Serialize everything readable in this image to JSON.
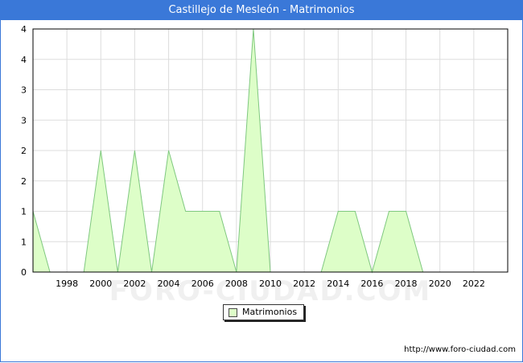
{
  "chart_data": {
    "type": "area",
    "title": "Castillejo de Mesleón - Matrimonios",
    "xlabel": "",
    "ylabel": "",
    "x": [
      1996,
      1997,
      1998,
      1999,
      2000,
      2001,
      2002,
      2003,
      2004,
      2005,
      2006,
      2007,
      2008,
      2009,
      2010,
      2011,
      2012,
      2013,
      2014,
      2015,
      2016,
      2017,
      2018,
      2019,
      2020,
      2021,
      2022,
      2023
    ],
    "series": [
      {
        "name": "Matrimonios",
        "values": [
          1,
          0,
          0,
          0,
          2,
          0,
          2,
          0,
          2,
          1,
          1,
          1,
          0,
          4,
          0,
          0,
          0,
          0,
          1,
          1,
          0,
          1,
          1,
          0,
          0,
          0,
          0,
          0
        ],
        "fill_color": "#ddfec8",
        "line_color": "#7fc87f"
      }
    ],
    "xlim": [
      1996,
      2024
    ],
    "ylim": [
      0,
      4
    ],
    "x_tick_labels": [
      "1998",
      "2000",
      "2002",
      "2004",
      "2006",
      "2008",
      "2010",
      "2012",
      "2014",
      "2016",
      "2018",
      "2020",
      "2022"
    ],
    "y_tick_labels": [
      "0",
      "1",
      "1",
      "2",
      "2",
      "3",
      "3",
      "4",
      "4"
    ],
    "grid": true,
    "legend_position": "bottom",
    "watermark": "FORO-CIUDAD.COM"
  },
  "footer": {
    "url": "http://www.foro-ciudad.com"
  }
}
